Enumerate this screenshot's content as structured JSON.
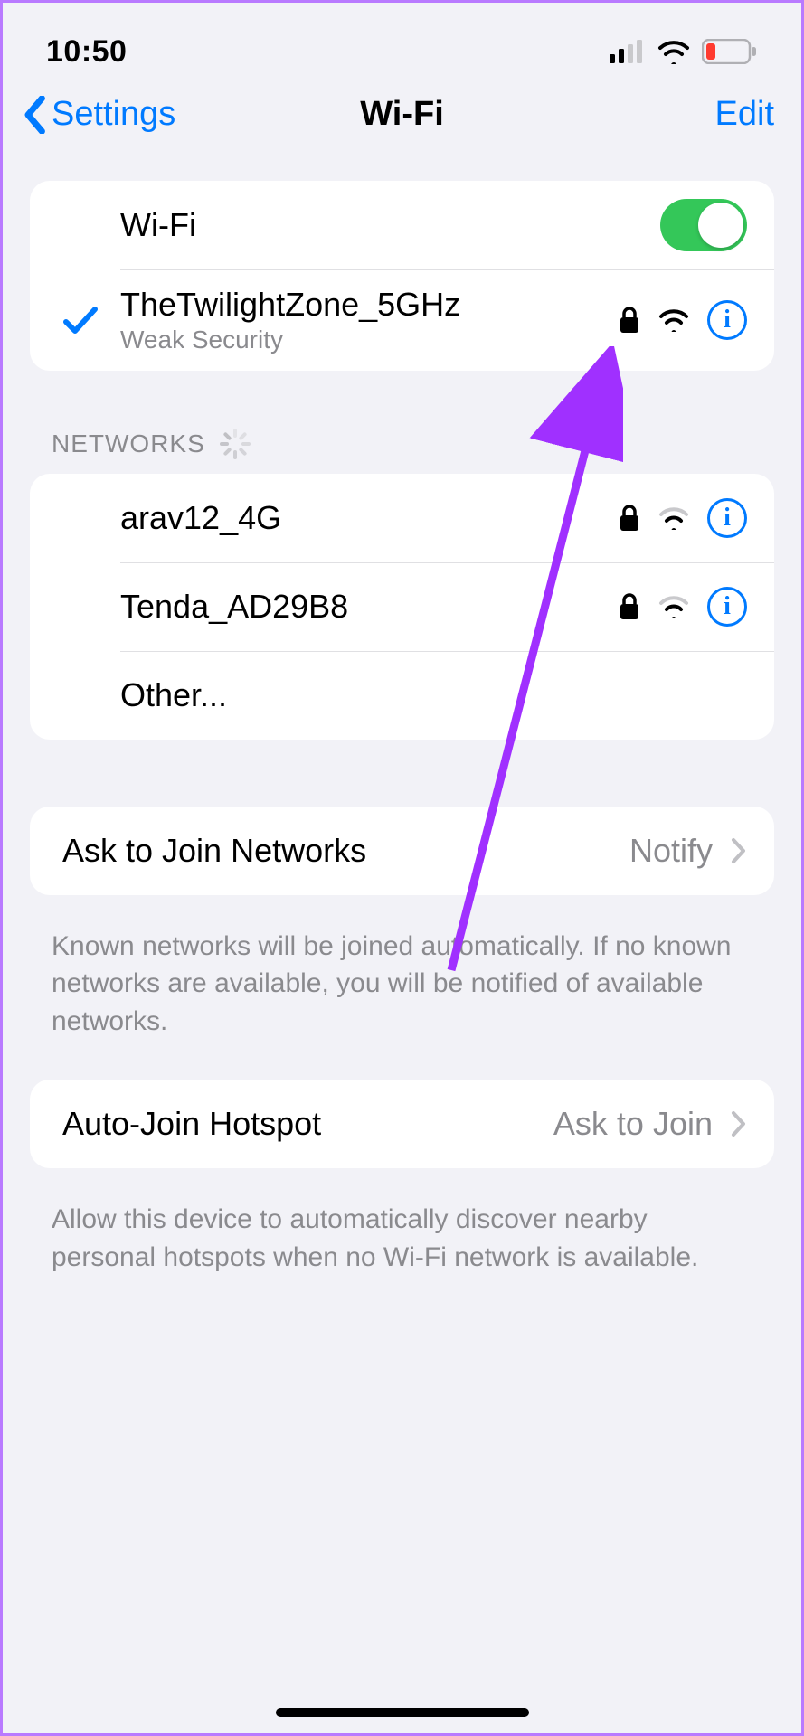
{
  "status": {
    "time": "10:50"
  },
  "nav": {
    "back": "Settings",
    "title": "Wi-Fi",
    "edit": "Edit"
  },
  "wifi": {
    "toggleLabel": "Wi-Fi",
    "connected": {
      "name": "TheTwilightZone_5GHz",
      "warning": "Weak Security"
    }
  },
  "sections": {
    "networksHeader": "NETWORKS",
    "networks": [
      {
        "name": "arav12_4G"
      },
      {
        "name": "Tenda_AD29B8"
      }
    ],
    "otherLabel": "Other..."
  },
  "askJoin": {
    "label": "Ask to Join Networks",
    "value": "Notify",
    "footer": "Known networks will be joined automatically. If no known networks are available, you will be notified of available networks."
  },
  "autoHotspot": {
    "label": "Auto-Join Hotspot",
    "value": "Ask to Join",
    "footer": "Allow this device to automatically discover nearby personal hotspots when no Wi-Fi network is available."
  }
}
